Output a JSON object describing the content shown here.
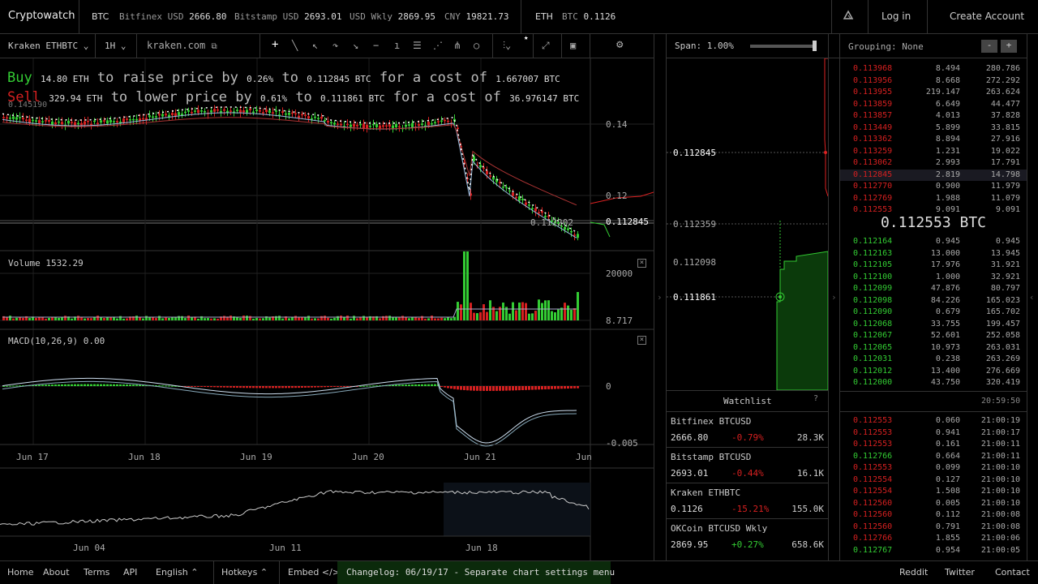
{
  "topbar": {
    "brand": "Cryptowatch",
    "btc_label": "BTC",
    "tickers": [
      {
        "name": "Bitfinex USD",
        "value": "2666.80"
      },
      {
        "name": "Bitstamp USD",
        "value": "2693.01"
      },
      {
        "name": "USD Wkly",
        "value": "2869.95"
      },
      {
        "name": "CNY",
        "value": "19821.73"
      }
    ],
    "eth_label": "ETH",
    "eth_ticker": {
      "name": "BTC",
      "value": "0.1126"
    },
    "login": "Log in",
    "create": "Create Account"
  },
  "toolbar": {
    "market": "Kraken ETHBTC",
    "period": "1H",
    "exchange_link": "kraken.com"
  },
  "overlay": {
    "buy_word": "Buy",
    "buy_qty": "14.80 ETH",
    "buy_mid": "to raise price by",
    "buy_pct": "0.26%",
    "buy_to": "to",
    "buy_price": "0.112845 BTC",
    "buy_cost_text": "for a cost of",
    "buy_cost": "1.667007 BTC",
    "sell_word": "Sell",
    "sell_qty": "329.94 ETH",
    "sell_mid": "to lower price by",
    "sell_pct": "0.61%",
    "sell_to": "to",
    "sell_price": "0.111861 BTC",
    "sell_cost_text": "for a cost of",
    "sell_cost": "36.976147 BTC",
    "hi_label": "0.145190"
  },
  "price_axis": {
    "t1": "0.14",
    "t2": "0.12",
    "low": "0.112202",
    "last": "0.112845"
  },
  "volume": {
    "label": "Volume",
    "value": "1532.29",
    "t1": "20000",
    "t2": "8.717"
  },
  "macd": {
    "label": "MACD(10,26,9)",
    "value": "0.00",
    "t1": "0",
    "t2": "-0.005"
  },
  "dates": [
    "Jun 17",
    "Jun 18",
    "Jun 19",
    "Jun 20",
    "Jun 21",
    "Jun"
  ],
  "nav_dates": [
    "Jun 04",
    "Jun 11",
    "Jun 18"
  ],
  "depth": {
    "span_label": "Span:",
    "span_value": "1.00%",
    "labels": [
      "0.112845",
      "0.112359",
      "0.112098",
      "0.111861"
    ]
  },
  "orderbook": {
    "grouping_label": "Grouping:",
    "grouping_value": "None",
    "asks": [
      [
        "0.113968",
        "8.494",
        "280.786"
      ],
      [
        "0.113956",
        "8.668",
        "272.292"
      ],
      [
        "0.113955",
        "219.147",
        "263.624"
      ],
      [
        "0.113859",
        "6.649",
        "44.477"
      ],
      [
        "0.113857",
        "4.013",
        "37.828"
      ],
      [
        "0.113449",
        "5.899",
        "33.815"
      ],
      [
        "0.113362",
        "8.894",
        "27.916"
      ],
      [
        "0.113259",
        "1.231",
        "19.022"
      ],
      [
        "0.113062",
        "2.993",
        "17.791"
      ],
      [
        "0.112845",
        "2.819",
        "14.798"
      ],
      [
        "0.112770",
        "0.900",
        "11.979"
      ],
      [
        "0.112769",
        "1.988",
        "11.079"
      ],
      [
        "0.112553",
        "9.091",
        "9.091"
      ]
    ],
    "last_price": "0.112553 BTC",
    "bids": [
      [
        "0.112164",
        "0.945",
        "0.945"
      ],
      [
        "0.112163",
        "13.000",
        "13.945"
      ],
      [
        "0.112105",
        "17.976",
        "31.921"
      ],
      [
        "0.112100",
        "1.000",
        "32.921"
      ],
      [
        "0.112099",
        "47.876",
        "80.797"
      ],
      [
        "0.112098",
        "84.226",
        "165.023"
      ],
      [
        "0.112090",
        "0.679",
        "165.702"
      ],
      [
        "0.112068",
        "33.755",
        "199.457"
      ],
      [
        "0.112067",
        "52.601",
        "252.058"
      ],
      [
        "0.112065",
        "10.973",
        "263.031"
      ],
      [
        "0.112031",
        "0.238",
        "263.269"
      ],
      [
        "0.112012",
        "13.400",
        "276.669"
      ],
      [
        "0.112000",
        "43.750",
        "320.419"
      ]
    ],
    "time": "20:59:50",
    "trades": [
      [
        "0.112553",
        "0.060",
        "21:00:19",
        "r"
      ],
      [
        "0.112553",
        "0.941",
        "21:00:17",
        "r"
      ],
      [
        "0.112553",
        "0.161",
        "21:00:11",
        "r"
      ],
      [
        "0.112766",
        "0.664",
        "21:00:11",
        "g"
      ],
      [
        "0.112553",
        "0.099",
        "21:00:10",
        "r"
      ],
      [
        "0.112554",
        "0.127",
        "21:00:10",
        "r"
      ],
      [
        "0.112554",
        "1.508",
        "21:00:10",
        "r"
      ],
      [
        "0.112560",
        "0.005",
        "21:00:10",
        "r"
      ],
      [
        "0.112560",
        "0.112",
        "21:00:08",
        "r"
      ],
      [
        "0.112560",
        "0.791",
        "21:00:08",
        "r"
      ],
      [
        "0.112766",
        "1.855",
        "21:00:06",
        "r"
      ],
      [
        "0.112767",
        "0.954",
        "21:00:05",
        "g"
      ]
    ]
  },
  "watchlist": {
    "title": "Watchlist",
    "help": "?",
    "items": [
      {
        "name": "Bitfinex BTCUSD",
        "price": "2666.80",
        "change": "-0.79%",
        "vol": "28.3K",
        "dir": "r"
      },
      {
        "name": "Bitstamp BTCUSD",
        "price": "2693.01",
        "change": "-0.44%",
        "vol": "16.1K",
        "dir": "r"
      },
      {
        "name": "Kraken ETHBTC",
        "price": "0.1126",
        "change": "-15.21%",
        "vol": "155.0K",
        "dir": "r"
      },
      {
        "name": "OKCoin BTCUSD Wkly",
        "price": "2869.95",
        "change": "+0.27%",
        "vol": "658.6K",
        "dir": "g"
      }
    ]
  },
  "footer": {
    "home": "Home",
    "about": "About",
    "terms": "Terms",
    "api": "API",
    "lang": "English",
    "hotkeys": "Hotkeys",
    "embed": "Embed",
    "changelog": "Changelog: 06/19/17 - Separate chart settings menu",
    "reddit": "Reddit",
    "twitter": "Twitter",
    "contact": "Contact"
  },
  "colors": {
    "up": "#33cc33",
    "down": "#d62020",
    "bg": "#000000",
    "border": "#333333"
  }
}
